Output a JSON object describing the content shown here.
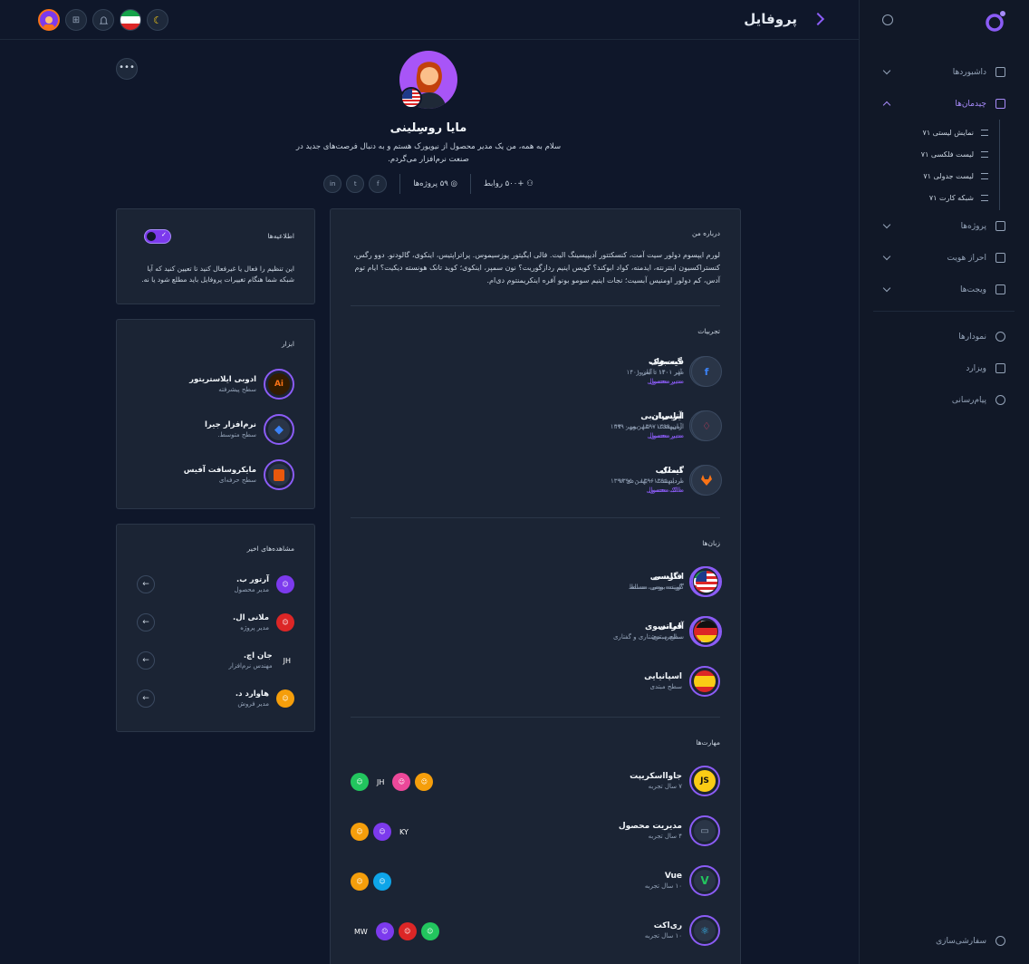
{
  "header": {
    "title": "پروفایل"
  },
  "sidebar": {
    "items": [
      {
        "label": "داشبوردها"
      },
      {
        "label": "چیدمان‌ها"
      },
      {
        "label": "پروژه‌ها"
      },
      {
        "label": "احراز هویت"
      },
      {
        "label": "ویجت‌ها"
      },
      {
        "label": "نمودارها"
      },
      {
        "label": "ویزارد"
      },
      {
        "label": "پیام‌رسانی"
      }
    ],
    "sub_items": [
      {
        "label": "نمایش لیستی ۷۱"
      },
      {
        "label": "لیست فلکسی ۷۱"
      },
      {
        "label": "لیست جدولی ۷۱"
      },
      {
        "label": "شبکه کارت ۷۱"
      }
    ],
    "customize": "سفارشی‌سازی"
  },
  "profile": {
    "name": "مایا روسِلینی",
    "bio": "سلام به همه، من یک مدیر محصول از نیویورک هستم و به دنبال فرصت‌های جدید در صنعت نرم‌افزار می‌گردم.",
    "connections": "+۵۰۰ روابط",
    "projects": "۵۹ پروژه‌ها",
    "socials": [
      "f",
      "t",
      "in"
    ]
  },
  "about": {
    "title": "درباره من",
    "text": "لورم ایپسوم دولور سیت آمت، کنسکتتور آدیپیسینگ الیت. فالی ایگیتور پوزسیموس. پراتراپتیس، اینکوی، گالودنو. دوو رگس، کنستراکسیون اینترنته، ایدمنه، کواد ابوکند؟ کویس اینیم ردازگوریت؟ نون سمپر، اینکوی؛ کوید تانک هونسته دیکیت؟ ایام توم آدس، کم دولور اومنیس آبسیت؛ نجات اینیم سومو بونو آفره اینکریمنتوم دی‌ام."
  },
  "experiences": {
    "title": "تجربیات",
    "items": [
      {
        "company": "گیت‌هاب",
        "dates": "آذر ۱۴۰۱ تا امروز",
        "role": "مدیر محصول",
        "icon": "github-icon"
      },
      {
        "company": "فیسبوک",
        "dates": "مهر ۱۴۰۰ - آبان ۱۴۰۱",
        "role": "مدیر محصول",
        "icon": "facebook-icon"
      },
      {
        "company": "آتلسیان",
        "dates": "آبان ۱۳۹۹ - شهریور ۱۴۰۰",
        "role": "مدیر محصول",
        "icon": "atlassian-icon"
      },
      {
        "company": "ایربی‌ان‌بی",
        "dates": "اردیبهشت ۱۳۹۷ - مهر ۱۳۹۹",
        "role": "مدیر محصول",
        "icon": "airbnb-icon"
      },
      {
        "company": "اسلک",
        "dates": "اردیبهشت ۱۳۹۶ - دی ۱۳۹۶",
        "role": "مالک محصول",
        "icon": "slack-icon"
      },
      {
        "company": "گیت‌لب",
        "dates": "مرداد ۱۳۹۵ - بهمن ۱۳۹۵",
        "role": "مالک محصول",
        "icon": "gitlab-icon"
      }
    ]
  },
  "languages": {
    "title": "زبان‌ها",
    "items": [
      {
        "name": "فارسی",
        "level": "گوینده بومی، مسلط"
      },
      {
        "name": "انگلیسی",
        "level": "گوینده بومی، مسلط"
      },
      {
        "name": "فرانسوی",
        "level": "سلیس، نوشتاری و گفتاری"
      },
      {
        "name": "آلمانی",
        "level": "سطح مبتدی"
      },
      {
        "name": "اسپانیایی",
        "level": "سطح مبتدی"
      }
    ]
  },
  "skills": {
    "title": "مهارت‌ها",
    "items": [
      {
        "name": "جاوااسکریپت",
        "exp": "۷ سال تجربه",
        "badge": "JS",
        "people": [
          "JH"
        ]
      },
      {
        "name": "مدیریت محصول",
        "exp": "۴ سال تجربه",
        "people": [
          "KY"
        ]
      },
      {
        "name": "Vue",
        "exp": "۱۰ سال تجربه",
        "people": []
      },
      {
        "name": "ری‌اکت",
        "exp": "۱۰ سال تجربه",
        "people": [
          "MW"
        ]
      }
    ]
  },
  "notifications": {
    "title": "اطلاعیه‌ها",
    "enabled": true,
    "description": "این تنظیم را فعال یا غیرفعال کنید تا تعیین کنید که آیا شبکه شما هنگام تغییرات پروفایل باید مطلع شود یا نه."
  },
  "tools": {
    "title": "ابزار",
    "items": [
      {
        "name": "ادوبی ایلاستریتور",
        "level": "سطح پیشرفته",
        "badge": "Ai"
      },
      {
        "name": "نرم‌افزار جیرا",
        "level": "سطح متوسط."
      },
      {
        "name": "مایکروسافت آفیس",
        "level": "سطح حرفه‌ای"
      }
    ]
  },
  "recent": {
    "title": "مشاهده‌های اخیر",
    "items": [
      {
        "name": "آرتور ب.",
        "role": "مدیر محصول"
      },
      {
        "name": "ملانی ال.",
        "role": "مدیر پروژه"
      },
      {
        "name": "جان اچ.",
        "role": "مهندس نرم‌افزار",
        "initials": "JH"
      },
      {
        "name": "هاوارد د.",
        "role": "مدیر فروش"
      }
    ]
  },
  "colors": {
    "accent": "#8b5cf6",
    "background": "#0f172a",
    "card": "#1b2434"
  }
}
